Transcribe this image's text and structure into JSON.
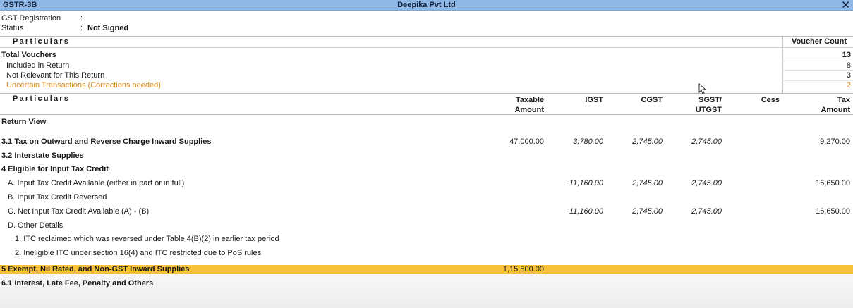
{
  "window": {
    "report_name": "GSTR-3B",
    "company": "Deepika Pvt Ltd",
    "close_glyph": "✕"
  },
  "info": {
    "gst_registration_label": "GST Registration",
    "gst_registration_colon": ":",
    "status_label": "Status",
    "status_colon": ":",
    "status_value": "Not Signed"
  },
  "summary": {
    "particulars_header": "Particulars",
    "count_header": "Voucher Count",
    "rows": [
      {
        "label": "Total Vouchers",
        "count": "13"
      },
      {
        "label": "Included in Return",
        "count": "8"
      },
      {
        "label": "Not Relevant for This Return",
        "count": "3"
      },
      {
        "label": "Uncertain Transactions (Corrections needed)",
        "count": "2"
      }
    ]
  },
  "table": {
    "headers": {
      "particulars": "Particulars",
      "taxable_1": "Taxable",
      "taxable_2": "Amount",
      "igst": "IGST",
      "cgst": "CGST",
      "sgst_1": "SGST/",
      "sgst_2": "UTGST",
      "cess": "Cess",
      "tax_1": "Tax",
      "tax_2": "Amount"
    },
    "return_view": "Return View",
    "rows": [
      {
        "label": "3.1 Tax on Outward and Reverse Charge Inward Supplies",
        "taxable": "47,000.00",
        "igst": "3,780.00",
        "cgst": "2,745.00",
        "sgst": "2,745.00",
        "tax": "9,270.00"
      },
      {
        "label": "3.2 Interstate Supplies"
      },
      {
        "label": "4 Eligible for Input Tax Credit"
      },
      {
        "label": "A. Input Tax Credit Available (either in part or in full)",
        "igst": "11,160.00",
        "cgst": "2,745.00",
        "sgst": "2,745.00",
        "tax": "16,650.00"
      },
      {
        "label": "B. Input Tax Credit Reversed"
      },
      {
        "label": "C. Net Input Tax Credit Available (A) - (B)",
        "igst": "11,160.00",
        "cgst": "2,745.00",
        "sgst": "2,745.00",
        "tax": "16,650.00"
      },
      {
        "label": "D. Other Details"
      },
      {
        "label": "1. ITC reclaimed which was reversed under Table 4(B)(2) in earlier tax period"
      },
      {
        "label": "2. Ineligible ITC under section 16(4) and ITC restricted due to PoS rules"
      },
      {
        "label": "5 Exempt, Nil Rated, and Non-GST Inward Supplies",
        "taxable": "1,15,500.00"
      },
      {
        "label": "6.1 Interest, Late Fee, Penalty and Others"
      }
    ]
  },
  "colors": {
    "titlebar": "#8fb8e6",
    "highlight": "#f7c23a",
    "uncertain": "#d98a1a"
  },
  "icons": {
    "cursor": "mouse-pointer-icon",
    "close": "close-icon"
  }
}
